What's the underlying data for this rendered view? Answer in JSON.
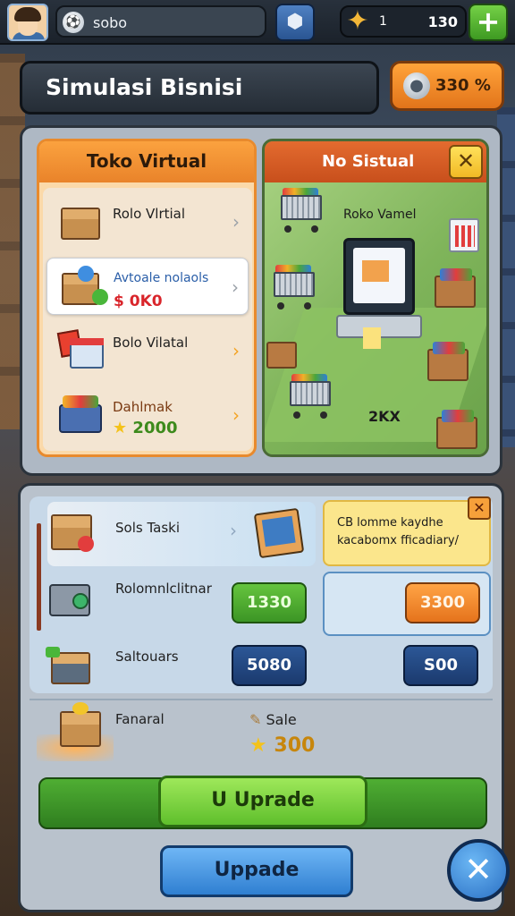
{
  "topbar": {
    "player_name": "sobo",
    "currency_small": "1",
    "currency_amount": "130",
    "plus_label": "+"
  },
  "title": {
    "text": "Simulasi Bisnisi",
    "cost": "330 %"
  },
  "left_panel": {
    "header": "Toko Virtual",
    "items": [
      {
        "label": "Rolo Vlrtial",
        "sub": ""
      },
      {
        "label": "Avtoale nolaols",
        "sub": "$ 0K0"
      },
      {
        "label": "Bolo Vilatal",
        "sub": ""
      },
      {
        "label": "Dahlmak",
        "sub": "2000"
      }
    ]
  },
  "right_panel": {
    "header": "No Sistual",
    "close_label": "✕",
    "scene_label": "Roko Vamel",
    "scene_value": "2KX"
  },
  "lower": {
    "tasks": [
      {
        "label": "Sols Taski"
      },
      {
        "label": "Rolomnlclitnar",
        "button": "1330"
      },
      {
        "label": "Saltouars",
        "button": "5080"
      }
    ],
    "note": {
      "text": "CB lomme kaydhe kacabomx fficadiary/",
      "close_label": "✕"
    },
    "side_buttons": [
      "3300",
      "S00"
    ],
    "reward": {
      "label": "Fanaral",
      "sale_label": "Sale",
      "sale_value": "300"
    },
    "upgrade_label": "U Uprade",
    "bottom_label": "Uppade",
    "close_label": "✕"
  },
  "colors": {
    "accent_orange": "#e9832a",
    "accent_green": "#5fbf2c",
    "accent_blue": "#2f7fd1",
    "price_red": "#d9252b"
  }
}
